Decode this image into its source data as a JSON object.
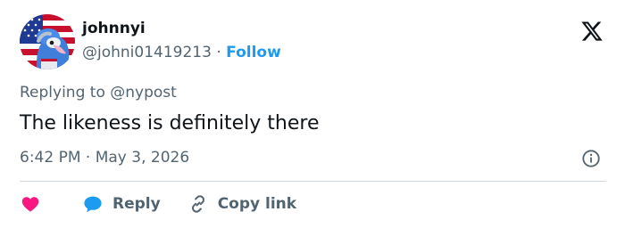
{
  "user": {
    "display_name": "johnnyi",
    "handle": "@johni01419213",
    "separator": " · ",
    "follow_label": "Follow",
    "avatar": "muppet-with-american-flag"
  },
  "tweet": {
    "replying_prefix": "Replying to ",
    "replying_to": "@nypost",
    "text": "The likeness is definitely there",
    "time": "6:42 PM",
    "separator": " · ",
    "date": "May 3, 2026"
  },
  "actions": {
    "reply_label": "Reply",
    "copy_link_label": "Copy link"
  },
  "icons": {
    "logo": "x-logo-icon",
    "info": "info-icon",
    "like": "heart-icon",
    "reply": "speech-bubble-icon",
    "copy_link": "link-icon"
  },
  "colors": {
    "accent": "#1d9bf0",
    "like": "#f91880",
    "text_primary": "#0f1419",
    "text_secondary": "#536471",
    "divider": "#cfd9de"
  }
}
